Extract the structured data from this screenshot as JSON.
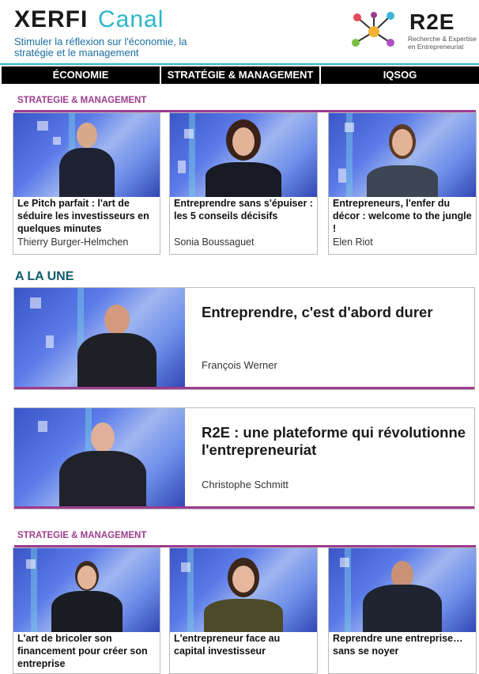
{
  "header": {
    "logo_xerfi": "XERFI",
    "logo_canal": "Canal",
    "tagline": "Stimuler la réflexion sur l'économie, la stratégie et le management",
    "partner_logo": "R2E",
    "partner_sub": "Recherche & Expertise en Entrepreneuriat"
  },
  "nav": [
    {
      "label": "ÉCONOMIE"
    },
    {
      "label": "STRATÉGIE & MANAGEMENT"
    },
    {
      "label": "IQSOG"
    }
  ],
  "section1": {
    "label": "STRATEGIE & MANAGEMENT",
    "cards": [
      {
        "title": "Le Pitch parfait : l'art de séduire les investisseurs en quelques minutes",
        "author": "Thierry Burger-Helmchen"
      },
      {
        "title": "Entreprendre sans s'épuiser : les 5 conseils décisifs",
        "author": "Sonia Boussaguet"
      },
      {
        "title": "Entrepreneurs, l'enfer du décor : welcome to the jungle !",
        "author": "Elen Riot"
      }
    ]
  },
  "une": {
    "label": "A LA UNE",
    "items": [
      {
        "title": "Entreprendre, c'est d'abord durer",
        "author": "François Werner"
      },
      {
        "title": "R2E : une plateforme qui révolutionne l'entrepreneuriat",
        "author": "Christophe Schmitt"
      }
    ]
  },
  "section2": {
    "label": "STRATEGIE & MANAGEMENT",
    "cards": [
      {
        "title": "L'art de bricoler son financement pour créer son entreprise"
      },
      {
        "title": "L'entrepreneur face au capital investisseur"
      },
      {
        "title": "Reprendre une entreprise… sans se noyer"
      }
    ]
  },
  "colors": {
    "accent": "#9b3d8e",
    "brand_teal": "#2bb6c9",
    "dark_teal": "#0d5a6e"
  },
  "icons": [
    "molecule-logo-icon"
  ]
}
